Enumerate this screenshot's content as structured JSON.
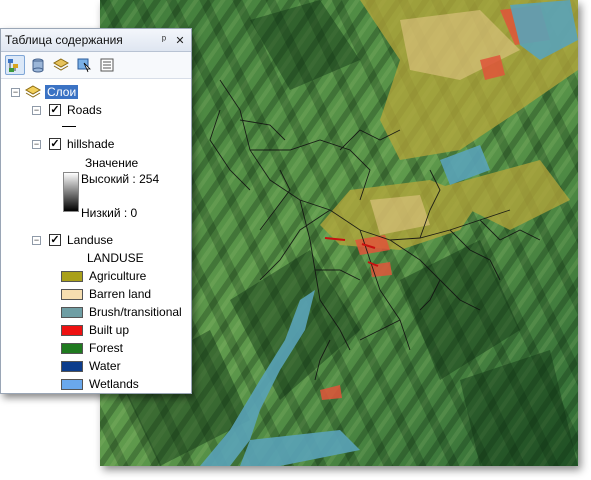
{
  "toc": {
    "title": "Таблица содержания",
    "pin_glyph": "ᵖ",
    "close_glyph": "✕",
    "toolbar": [
      {
        "icon": "list-by-drawing-order-icon",
        "active": true
      },
      {
        "icon": "list-by-source-icon",
        "active": false
      },
      {
        "icon": "list-by-visibility-icon",
        "active": false
      },
      {
        "icon": "list-by-selection-icon",
        "active": false
      },
      {
        "icon": "options-icon",
        "active": false
      }
    ],
    "root_label": "Слои",
    "layers": {
      "roads": {
        "name": "Roads",
        "checked": true
      },
      "hillshade": {
        "name": "hillshade",
        "checked": true,
        "value_heading": "Значение",
        "high_label": "Высокий : 254",
        "low_label": "Низкий : 0"
      },
      "landuse": {
        "name": "Landuse",
        "checked": true,
        "field_heading": "LANDUSE",
        "classes": [
          {
            "label": "Agriculture",
            "color": "#a9a01a"
          },
          {
            "label": "Barren land",
            "color": "#f6deb0"
          },
          {
            "label": "Brush/transitional",
            "color": "#6f9ea4"
          },
          {
            "label": "Built up",
            "color": "#ee1111"
          },
          {
            "label": "Forest",
            "color": "#1f7a1f"
          },
          {
            "label": "Water",
            "color": "#0c3d8c"
          },
          {
            "label": "Wetlands",
            "color": "#6aa8ec"
          }
        ]
      }
    }
  }
}
